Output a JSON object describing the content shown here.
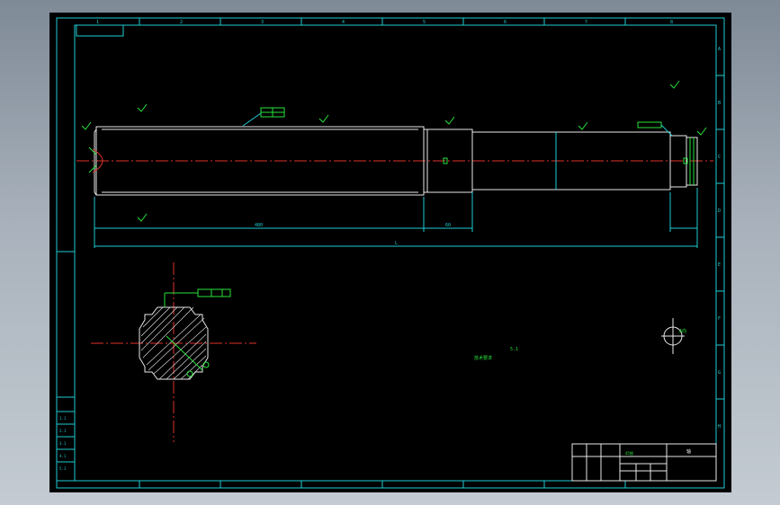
{
  "colors": {
    "background": "#000000",
    "frame": "#1ecbd3",
    "outline": "#e9e9e9",
    "annotation": "#27e33b",
    "centerline": "#e0322a"
  },
  "border": {
    "top_zones": [
      "1",
      "2",
      "3",
      "4",
      "5",
      "6",
      "7",
      "8"
    ],
    "side_zones": [
      "A",
      "B",
      "C",
      "D",
      "E",
      "F",
      "G",
      "H"
    ]
  },
  "annotations": {
    "note_a": "技术要求",
    "note_b": "5.1",
    "detail_ref": "A向"
  },
  "dimensions": {
    "overall": "L",
    "main_length": "480",
    "step_length": "60"
  },
  "title_block": {
    "drawing_title": "轴",
    "material_label": "45钢"
  },
  "revision_table": {
    "rows": [
      "1.1",
      "2.1",
      "3.1",
      "4.1",
      "5.1",
      "6.1"
    ]
  }
}
